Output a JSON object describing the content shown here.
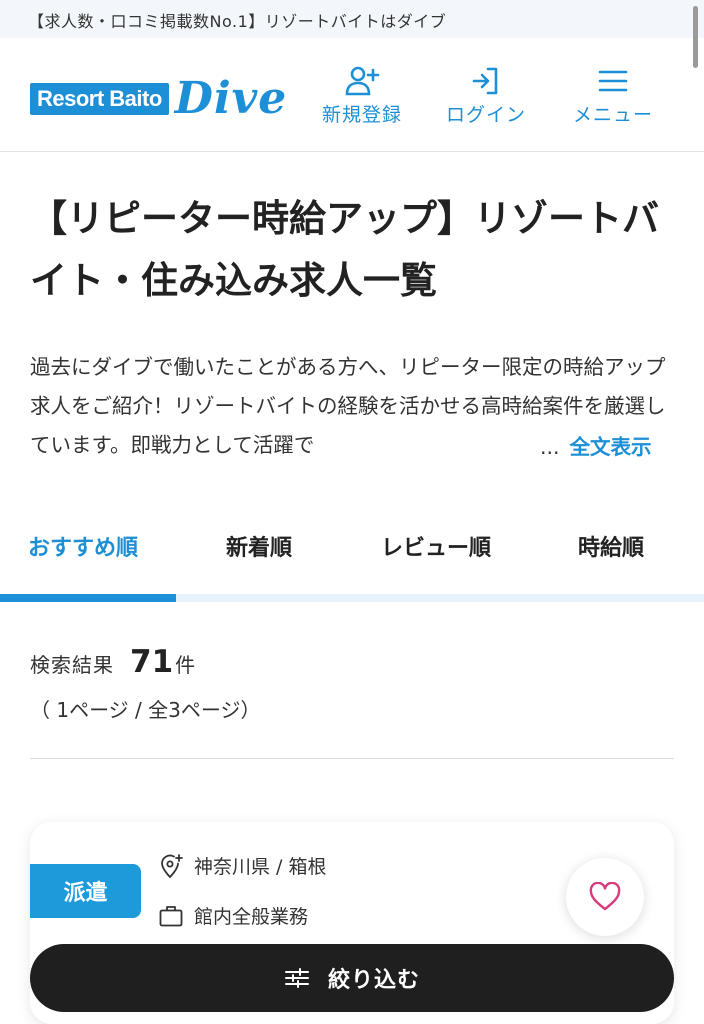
{
  "topbar": {
    "text": "【求人数・口コミ掲載数No.1】リゾートバイトはダイブ"
  },
  "header": {
    "logo_resort": "Resort Baito",
    "logo_dive": "Dive",
    "register_label": "新規登録",
    "login_label": "ログイン",
    "menu_label": "メニュー",
    "icons": [
      "user-plus-icon",
      "login-icon",
      "hamburger-menu-icon"
    ]
  },
  "page": {
    "title": "【リピーター時給アップ】リゾートバイト・住み込み求人一覧",
    "description": "過去にダイブで働いたことがある方へ、リピーター限定の時給アップ求人をご紹介！リゾートバイトの経験を活かせる高時給案件を厳選しています。即戦力として活躍で",
    "ellipsis": "...",
    "show_full": "全文表示"
  },
  "tabs": {
    "items": [
      {
        "label": "おすすめ順",
        "active": true
      },
      {
        "label": "新着順",
        "active": false
      },
      {
        "label": "レビュー順",
        "active": false
      },
      {
        "label": "時給順",
        "active": false
      }
    ]
  },
  "results": {
    "label": "検索結果",
    "count": "71",
    "unit": "件",
    "pages": "（ 1ページ /  全3ページ）"
  },
  "card": {
    "badge": "派遣",
    "location": "神奈川県 / 箱根",
    "job": "館内全般業務"
  },
  "filter": {
    "label": "絞り込む"
  },
  "colors": {
    "accent": "#1d8fd6",
    "badge": "#1d9ad9",
    "heart": "#d63c7b",
    "filter_bg": "#1f1f1f",
    "topbar_bg": "#f3f7fb"
  }
}
